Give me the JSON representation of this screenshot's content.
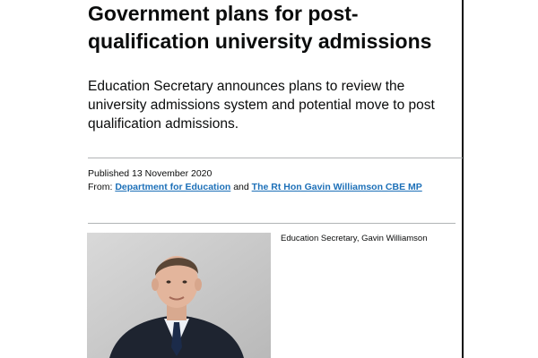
{
  "article": {
    "title": "Government plans for post-qualification university admissions",
    "summary": "Education Secretary announces plans to review the university admissions system and potential move to post qualification admissions.",
    "published_label": "Published",
    "published_date": "13 November 2020",
    "from_label": "From:",
    "from_org": "Department for Education",
    "from_conjunction": "and",
    "from_person": "The Rt Hon Gavin Williamson CBE MP",
    "image_caption": "Education Secretary, Gavin Williamson"
  },
  "colors": {
    "link": "#1d70b8",
    "text": "#0b0c0c",
    "rule": "#b1b4b6"
  }
}
